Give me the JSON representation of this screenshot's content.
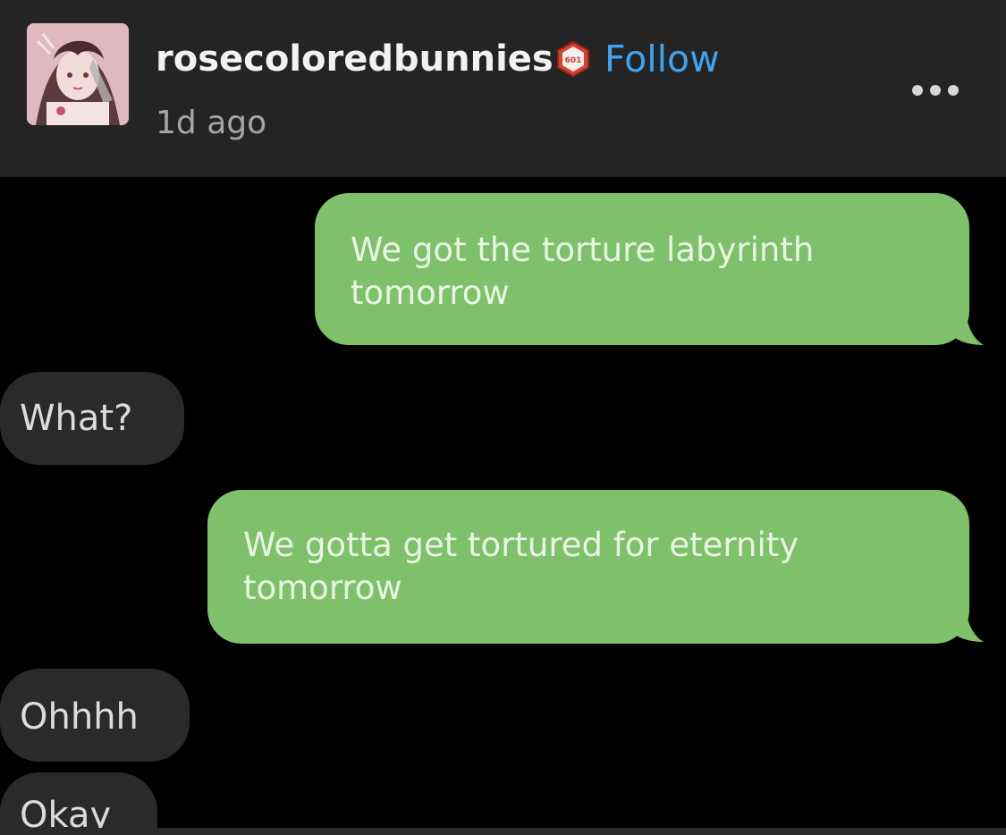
{
  "post": {
    "username": "rosecoloredbunnies",
    "badge": {
      "icon": "hexagon-badge-icon",
      "number": "601",
      "color": "#d8432e"
    },
    "follow_label": "Follow",
    "timestamp": "1d ago",
    "more_icon": "more-horizontal-icon"
  },
  "chat": {
    "messages": [
      {
        "sender": "me",
        "lines": [
          "We got the torture labyrinth",
          "tomorrow"
        ]
      },
      {
        "sender": "them",
        "lines": [
          "What?"
        ]
      },
      {
        "sender": "me",
        "lines": [
          "We gotta get tortured for eternity",
          "tomorrow"
        ]
      },
      {
        "sender": "them",
        "lines": [
          "Ohhhh"
        ]
      },
      {
        "sender": "them",
        "lines": [
          "Okay"
        ]
      }
    ]
  },
  "colors": {
    "header_bg": "#242424",
    "accent_follow": "#3ea4f0",
    "sent_bubble": "#7ec16a",
    "received_bubble": "#2a2a2c",
    "chat_bg": "#000000"
  }
}
